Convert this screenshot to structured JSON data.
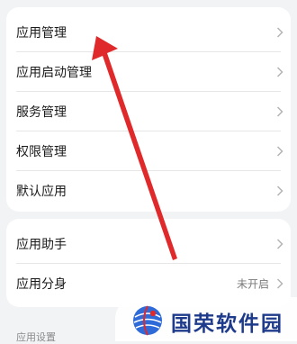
{
  "group1": {
    "items": [
      {
        "label": "应用管理"
      },
      {
        "label": "应用启动管理"
      },
      {
        "label": "服务管理"
      },
      {
        "label": "权限管理"
      },
      {
        "label": "默认应用"
      }
    ]
  },
  "group2": {
    "items": [
      {
        "label": "应用助手"
      },
      {
        "label": "应用分身",
        "value": "未开启"
      }
    ]
  },
  "section": {
    "label": "应用设置"
  },
  "watermark": {
    "text": "国荣软件园"
  },
  "icons": {
    "chevron": "chevron-right-icon",
    "annotation": "red-arrow-annotation",
    "logo": "globe-logo-icon"
  },
  "colors": {
    "arrow": "#e0292a",
    "watermark_text": "#1e3a8a",
    "background": "#f1f3f5",
    "card": "#ffffff"
  }
}
